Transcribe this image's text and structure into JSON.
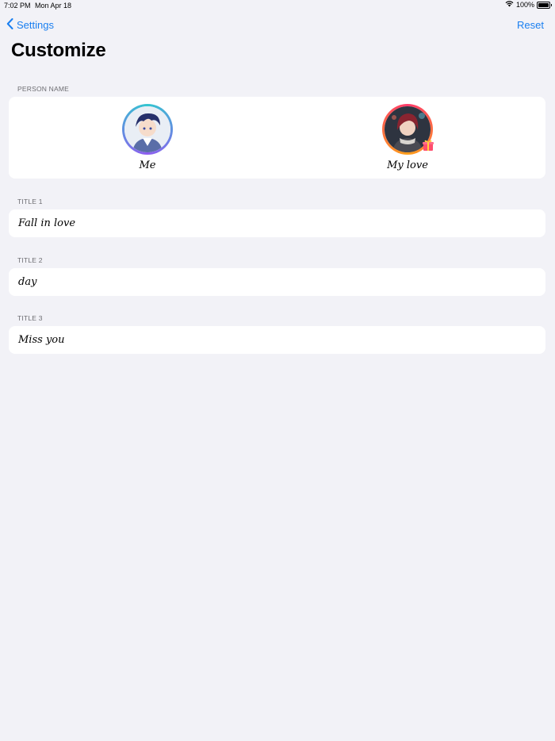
{
  "status_bar": {
    "time": "7:02 PM",
    "date": "Mon Apr 18",
    "battery_text": "100%",
    "battery_level": 1.0,
    "icons": [
      "wifi-icon",
      "battery-icon"
    ]
  },
  "nav": {
    "back_label": "Settings",
    "back_icon": "chevron-left-icon",
    "reset_label": "Reset",
    "accent_color": "#1a7ff0"
  },
  "page": {
    "title": "Customize"
  },
  "person_section": {
    "label": "PERSON NAME",
    "people": [
      {
        "name": "Me",
        "ring_colors": [
          "#33c6d0",
          "#8e5cf0"
        ]
      },
      {
        "name": "My love",
        "ring_colors": [
          "#ff3b6b",
          "#ff9f1a"
        ]
      }
    ]
  },
  "titles": [
    {
      "label": "TITLE 1",
      "value": "Fall in love"
    },
    {
      "label": "TITLE 2",
      "value": "day"
    },
    {
      "label": "TITLE 3",
      "value": "Miss you"
    }
  ]
}
